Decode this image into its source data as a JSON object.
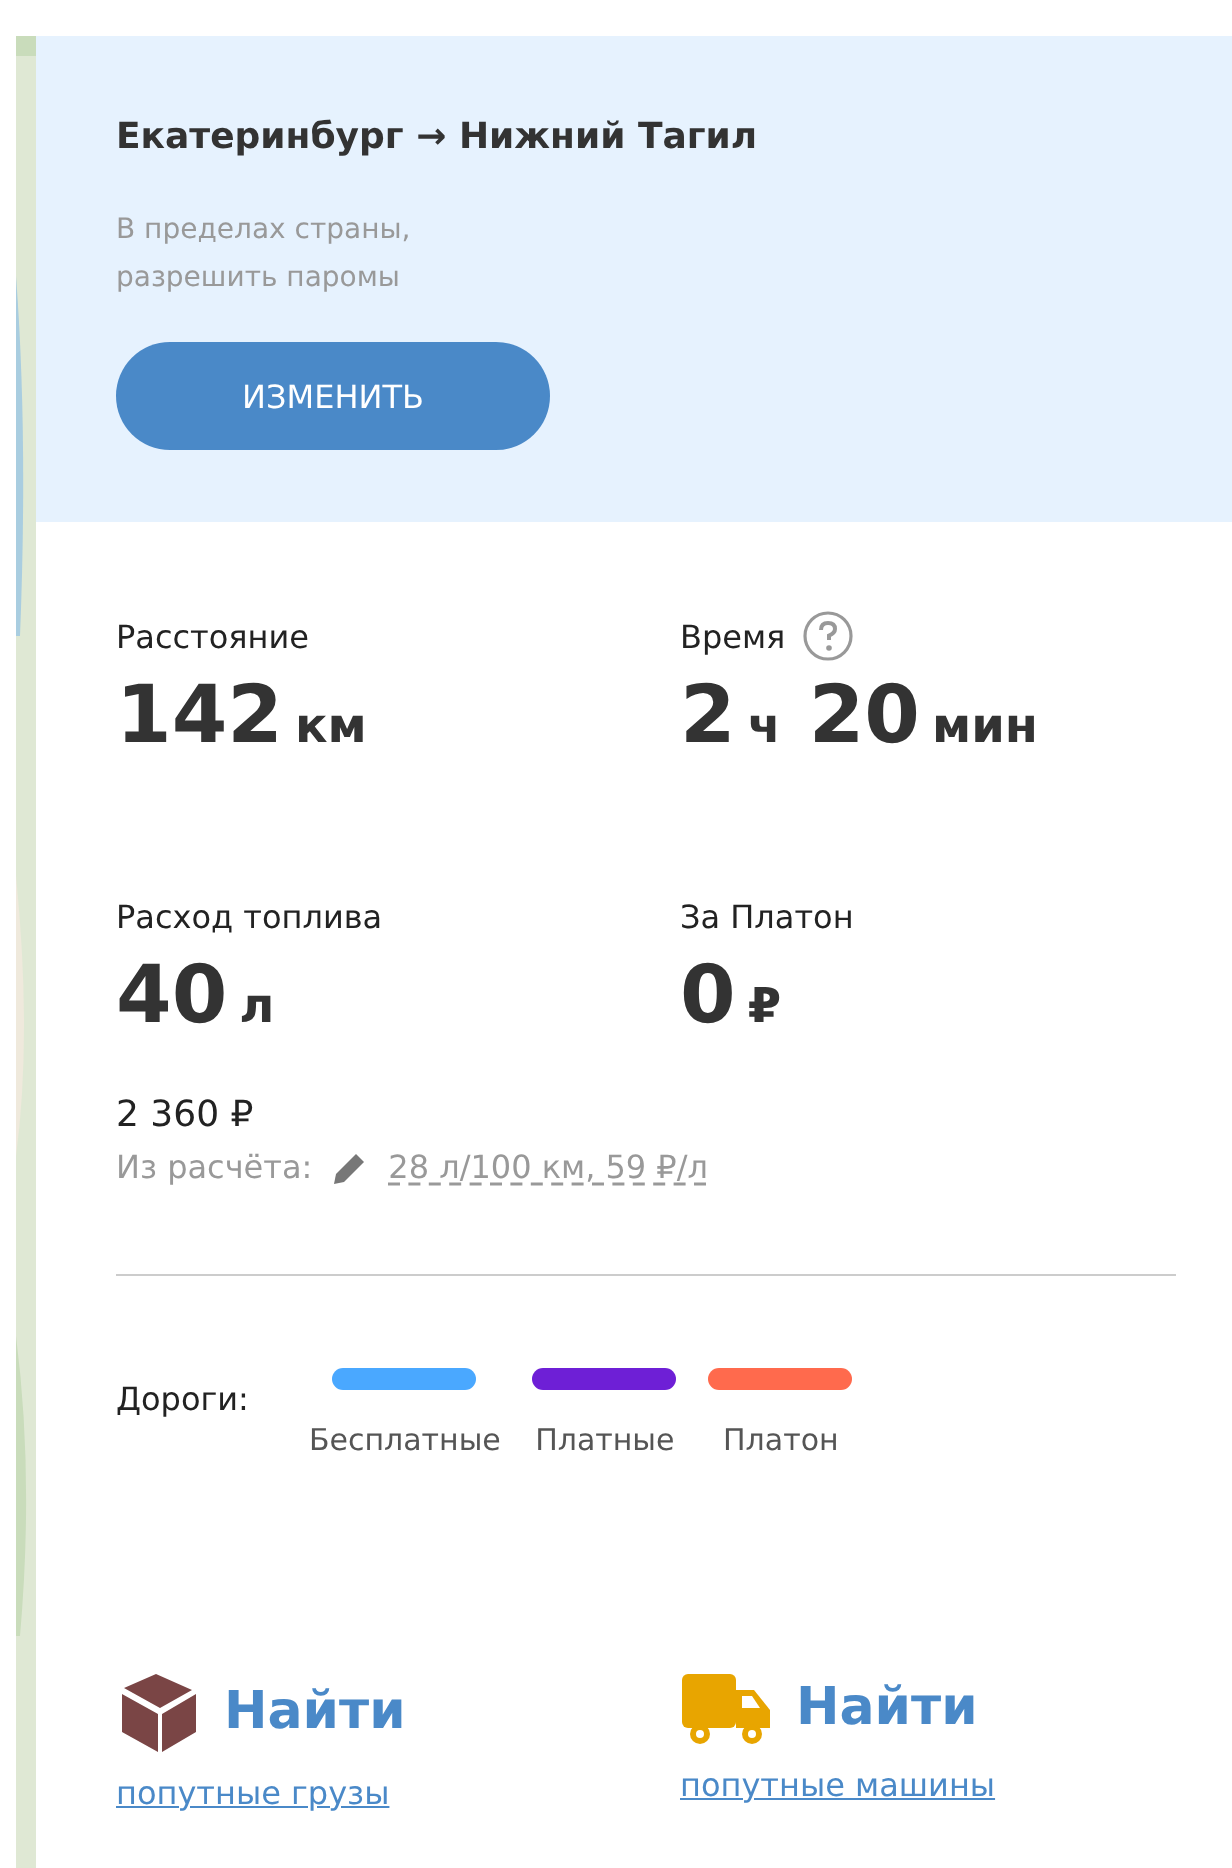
{
  "route": {
    "title": "Екатеринбург → Нижний Тагил",
    "options": [
      "В пределах страны,",
      "разрешить паромы"
    ],
    "button": "ИЗМЕНИТЬ"
  },
  "stats": [
    {
      "label": "Расстояние",
      "help": false,
      "parts": [
        {
          "number": "142",
          "unit": "км"
        }
      ]
    },
    {
      "label": "Время",
      "help": true,
      "parts": [
        {
          "number": "2",
          "unit": "ч"
        },
        {
          "number": "20",
          "unit": "мин"
        }
      ]
    },
    {
      "label": "Расход топлива",
      "help": false,
      "parts": [
        {
          "number": "40",
          "unit": "л"
        }
      ]
    },
    {
      "label": "За Платон",
      "help": false,
      "parts": [
        {
          "number": "0",
          "unit": "₽"
        }
      ]
    }
  ],
  "fuel_cost": "2 360 ₽",
  "calculation": {
    "label": "Из расчёта:",
    "value": "28 л/100 км, 59 ₽/л"
  },
  "roads": {
    "label": "Дороги:",
    "items": [
      {
        "name": "Бесплатные",
        "color": "#4aa8ff"
      },
      {
        "name": "Платные",
        "color": "#6e1fd6"
      },
      {
        "name": "Платон",
        "color": "#ff6a4d"
      }
    ]
  },
  "finds": [
    {
      "kind": "cargo",
      "title": "Найти",
      "link": "попутные грузы"
    },
    {
      "kind": "truck",
      "title": "Найти",
      "link": "попутные машины"
    }
  ]
}
